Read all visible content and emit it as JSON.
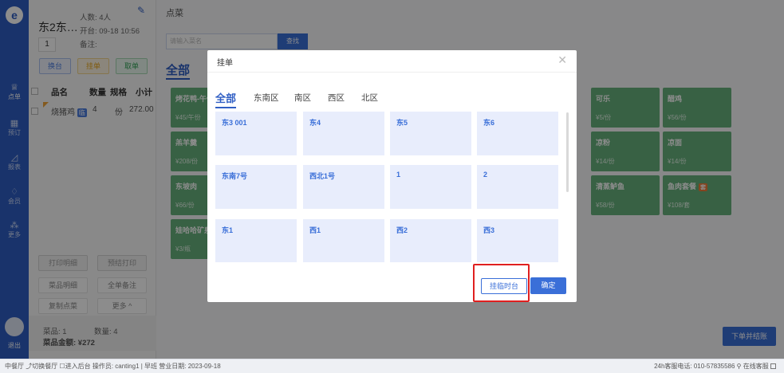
{
  "nav": {
    "items": [
      {
        "icon": "dish-icon",
        "glyph": "♕",
        "label": "点单",
        "active": true
      },
      {
        "icon": "calendar-icon",
        "glyph": "▦",
        "label": "预订",
        "active": false
      },
      {
        "icon": "chart-icon",
        "glyph": "◿",
        "label": "报表",
        "active": false
      },
      {
        "icon": "vip-icon",
        "glyph": "♢",
        "label": "会员",
        "active": false
      },
      {
        "icon": "more-icon",
        "glyph": "⁂",
        "label": "更多",
        "active": false
      }
    ],
    "logout": "退出"
  },
  "order": {
    "table_name": "东2东…",
    "guests": "人数: 4人",
    "open_time": "开台: 09-18 10:56",
    "guest_count": "1",
    "remark": "备注:",
    "actions": {
      "change_table": "换台",
      "hold": "挂单",
      "cancel": "取单"
    },
    "columns": {
      "name": "品名",
      "qty": "数量",
      "unit": "规格",
      "subtotal": "小计"
    },
    "items": [
      {
        "name": "烧猪鸡",
        "badge": "临",
        "qty": "4",
        "unit": "份",
        "subtotal": "272.00"
      }
    ],
    "bottom_buttons": {
      "print_menu": "打印明细",
      "pre_print": "预结打印",
      "dish_detail": "菜品明细",
      "all_remark": "全单备注",
      "copy_order": "复制点菜",
      "more": "更多 ^"
    },
    "summary": {
      "dish_count": "菜品: 1",
      "quantity": "数量: 4",
      "amount": "菜品金额: ¥272"
    }
  },
  "main": {
    "title": "点菜",
    "search_placeholder": "请输入菜名",
    "search_button": "查找",
    "category_all": "全部",
    "dishes": [
      {
        "name": "烤花鸭-午份",
        "price": "¥45/午份"
      },
      {
        "name": "羔羊羹",
        "price": "¥208/份"
      },
      {
        "name": "东坡肉",
        "price": "¥66/份"
      },
      {
        "name": "娃哈哈矿泉",
        "price": "¥3/瓶"
      },
      {
        "name": "可乐",
        "price": "¥5/份"
      },
      {
        "name": "醋鸡",
        "price": "¥56/份"
      },
      {
        "name": "凉粉",
        "price": "¥14/份"
      },
      {
        "name": "凉面",
        "price": "¥14/份"
      },
      {
        "name": "清蒸鲈鱼",
        "price": "¥58/份"
      },
      {
        "name": "鱼肉套餐",
        "badge": "套",
        "price": "¥108/套"
      }
    ],
    "checkout": "下单并结账"
  },
  "modal": {
    "title": "挂单",
    "tabs": [
      "全部",
      "东南区",
      "南区",
      "西区",
      "北区"
    ],
    "tables": [
      "东3 001",
      "东4",
      "东5",
      "东6",
      "东南7号",
      "西北1号",
      "1",
      "2",
      "东1",
      "西1",
      "西2",
      "西3"
    ],
    "temp_button": "挂临时台",
    "confirm_button": "确定"
  },
  "status": {
    "left": "中餐厅 ⤴切换餐厅   ☐进入后台   操作员: canting1  |  早班  营业日期: 2023-09-18",
    "right": "24h客服电话: 010-57835586   ⚲ 在线客服"
  }
}
